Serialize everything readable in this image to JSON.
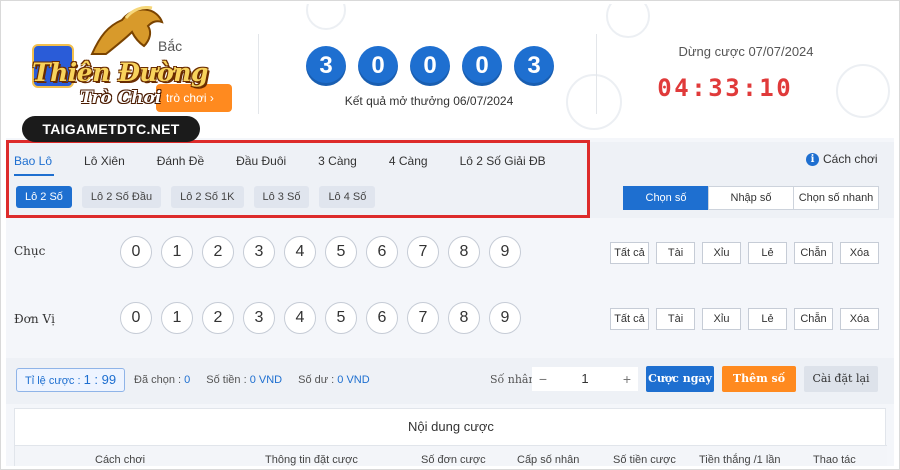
{
  "header": {
    "region_label": "Bắc",
    "play_button": "trò chơi",
    "result_digits": [
      "3",
      "0",
      "0",
      "0",
      "3"
    ],
    "result_date": "Kết quả mở thưởng 06/07/2024",
    "stop_label": "Dừng cược 07/07/2024",
    "countdown": [
      "0",
      "4",
      ":",
      "3",
      "3",
      ":",
      "1",
      "0"
    ]
  },
  "logo": {
    "title": "Thiên Đường",
    "subtitle": "Trò Chơi",
    "site": "TAIGAMETDTC.NET"
  },
  "tabs": [
    {
      "label": "Bao Lô",
      "active": true
    },
    {
      "label": "Lô Xiên",
      "active": false
    },
    {
      "label": "Đánh Đề",
      "active": false
    },
    {
      "label": "Đầu Đuôi",
      "active": false
    },
    {
      "label": "3 Càng",
      "active": false
    },
    {
      "label": "4 Càng",
      "active": false
    },
    {
      "label": "Lô 2 Số Giải ĐB",
      "active": false
    }
  ],
  "help_label": "Cách chơi",
  "help_icon": "info-icon",
  "subtabs": [
    {
      "label": "Lô 2 Số",
      "active": true
    },
    {
      "label": "Lô 2 Số Đầu",
      "active": false
    },
    {
      "label": "Lô 2 Số 1K",
      "active": false
    },
    {
      "label": "Lô 3 Số",
      "active": false
    },
    {
      "label": "Lô 4 Số",
      "active": false
    }
  ],
  "modes": [
    {
      "label": "Chọn số",
      "active": true
    },
    {
      "label": "Nhập số",
      "active": false
    },
    {
      "label": "Chọn số nhanh",
      "active": false
    }
  ],
  "rows": [
    {
      "label": "Chục",
      "digits": [
        "0",
        "1",
        "2",
        "3",
        "4",
        "5",
        "6",
        "7",
        "8",
        "9"
      ]
    },
    {
      "label": "Đơn Vị",
      "digits": [
        "0",
        "1",
        "2",
        "3",
        "4",
        "5",
        "6",
        "7",
        "8",
        "9"
      ]
    }
  ],
  "quick_buttons": [
    "Tất cả",
    "Tài",
    "Xỉu",
    "Lẻ",
    "Chẵn",
    "Xóa"
  ],
  "footer": {
    "ratio_label": "Tỉ lệ cược :",
    "ratio_value": "1 : 99",
    "chosen_label": "Đã chọn :",
    "chosen_value": "0",
    "amount_label": "Số tiền :",
    "amount_value": "0 VND",
    "balance_label": "Số dư :",
    "balance_value": "0 VND",
    "multiplier_label": "Số nhân :",
    "multiplier_value": "1",
    "minus": "−",
    "plus": "+",
    "bet_now": "Cược ngay",
    "add_number": "Thêm số",
    "reset": "Cài đặt lại"
  },
  "table": {
    "title": "Nội dung cược",
    "columns": [
      "Cách chơi",
      "Thông tin đặt cược",
      "Số đơn cược",
      "Cấp số nhân",
      "Số tiền cược",
      "Tiền thắng /1 lần",
      "Thao tác"
    ]
  },
  "colors": {
    "accent": "#1e6fd0",
    "countdown": "#e03a3a",
    "orange": "#ff8a1f",
    "highlight_border": "#dd2b2b"
  }
}
